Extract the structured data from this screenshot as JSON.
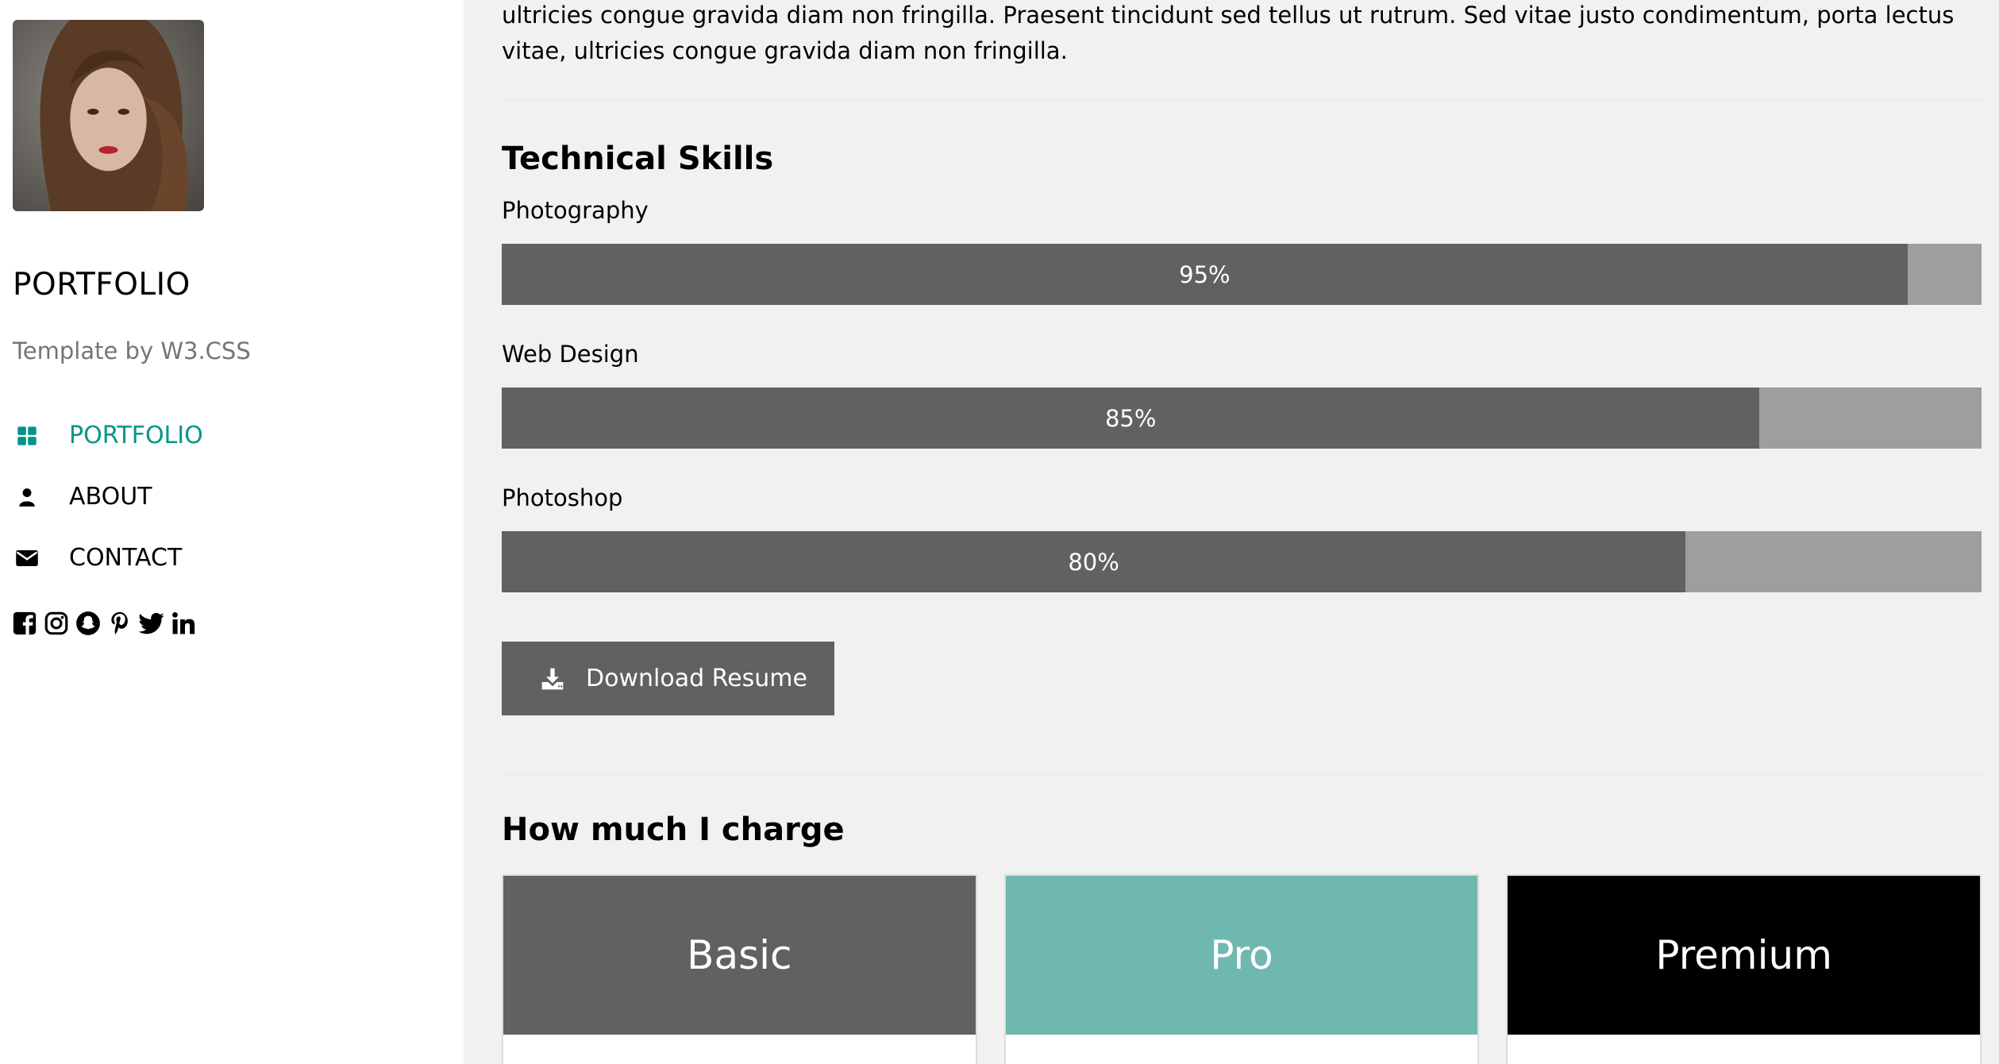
{
  "sidebar": {
    "brand": "PORTFOLIO",
    "tagline": "Template by W3.CSS",
    "nav": [
      {
        "label": "PORTFOLIO",
        "icon": "grid-icon",
        "active": true
      },
      {
        "label": "ABOUT",
        "icon": "user-icon",
        "active": false
      },
      {
        "label": "CONTACT",
        "icon": "envelope-icon",
        "active": false
      }
    ],
    "social_icons": [
      "facebook-icon",
      "instagram-icon",
      "snapchat-icon",
      "pinterest-icon",
      "twitter-icon",
      "linkedin-icon"
    ]
  },
  "main": {
    "intro_text": "ultricies congue gravida diam non fringilla. Praesent tincidunt sed tellus ut rutrum. Sed vitae justo condimentum, porta lectus vitae, ultricies congue gravida diam non fringilla.",
    "skills_heading": "Technical Skills",
    "skills": [
      {
        "name": "Photography",
        "percent": 95,
        "label": "95%"
      },
      {
        "name": "Web Design",
        "percent": 85,
        "label": "85%"
      },
      {
        "name": "Photoshop",
        "percent": 80,
        "label": "80%"
      }
    ],
    "download_label": "Download Resume",
    "pricing_heading": "How much I charge",
    "plans": [
      {
        "name": "Basic",
        "color": "#616161"
      },
      {
        "name": "Pro",
        "color": "#6fb8b0"
      },
      {
        "name": "Premium",
        "color": "#000000"
      }
    ]
  },
  "colors": {
    "accent": "#009688",
    "bar_fill": "#616161",
    "bar_track": "#9e9e9e",
    "background": "#f1f1f1"
  }
}
